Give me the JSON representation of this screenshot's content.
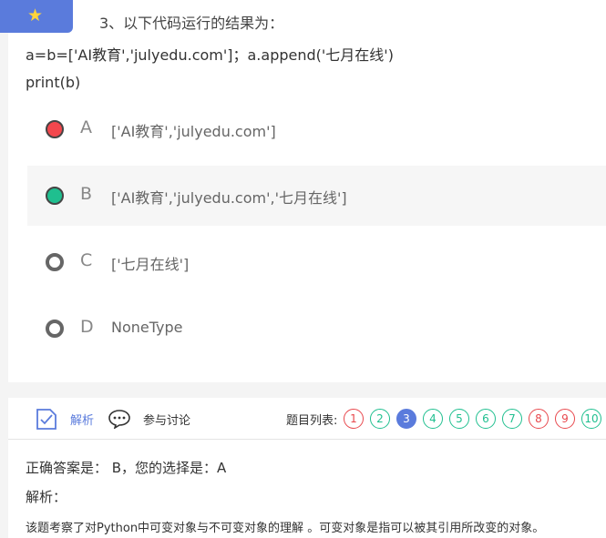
{
  "question": {
    "title": "3、以下代码运行的结果为：",
    "code_line1": "a=b=['AI教育','julyedu.com']；a.append('七月在线')",
    "code_line2": "print(b)"
  },
  "options": [
    {
      "letter": "A",
      "text": "['AI教育','julyedu.com']",
      "radio_color": "#f2474d",
      "state": "wrong-choice"
    },
    {
      "letter": "B",
      "text": "['AI教育','julyedu.com','七月在线']",
      "radio_color": "#1fbf8f",
      "state": "correct"
    },
    {
      "letter": "C",
      "text": "['七月在线']",
      "radio_color": "#666666",
      "state": "unselected"
    },
    {
      "letter": "D",
      "text": "NoneType",
      "radio_color": "#666666",
      "state": "unselected"
    }
  ],
  "toolbar": {
    "analysis_label": "解析",
    "discuss_label": "参与讨论",
    "question_list_label": "题目列表:",
    "accent_color": "#5a7bdc"
  },
  "question_list": [
    {
      "num": "1",
      "status": "wrong",
      "color": "#e8484d"
    },
    {
      "num": "2",
      "status": "correct",
      "color": "#1fbf8f"
    },
    {
      "num": "3",
      "status": "current",
      "color": "#5a7bdc"
    },
    {
      "num": "4",
      "status": "correct",
      "color": "#1fbf8f"
    },
    {
      "num": "5",
      "status": "correct",
      "color": "#1fbf8f"
    },
    {
      "num": "6",
      "status": "correct",
      "color": "#1fbf8f"
    },
    {
      "num": "7",
      "status": "correct",
      "color": "#1fbf8f"
    },
    {
      "num": "8",
      "status": "wrong",
      "color": "#e8484d"
    },
    {
      "num": "9",
      "status": "wrong",
      "color": "#e8484d"
    },
    {
      "num": "10",
      "status": "correct",
      "color": "#1fbf8f"
    }
  ],
  "answer": {
    "correct_line": "正确答案是： B，您的选择是：A",
    "analysis_heading": "解析：",
    "explanation": "该题考察了对Python中可变对象与不可变对象的理解 。可变对象是指可以被其引用所改变的对象。"
  },
  "icons": {
    "star": "star-icon",
    "analysis": "document-check-icon",
    "discuss": "chat-bubble-icon"
  }
}
